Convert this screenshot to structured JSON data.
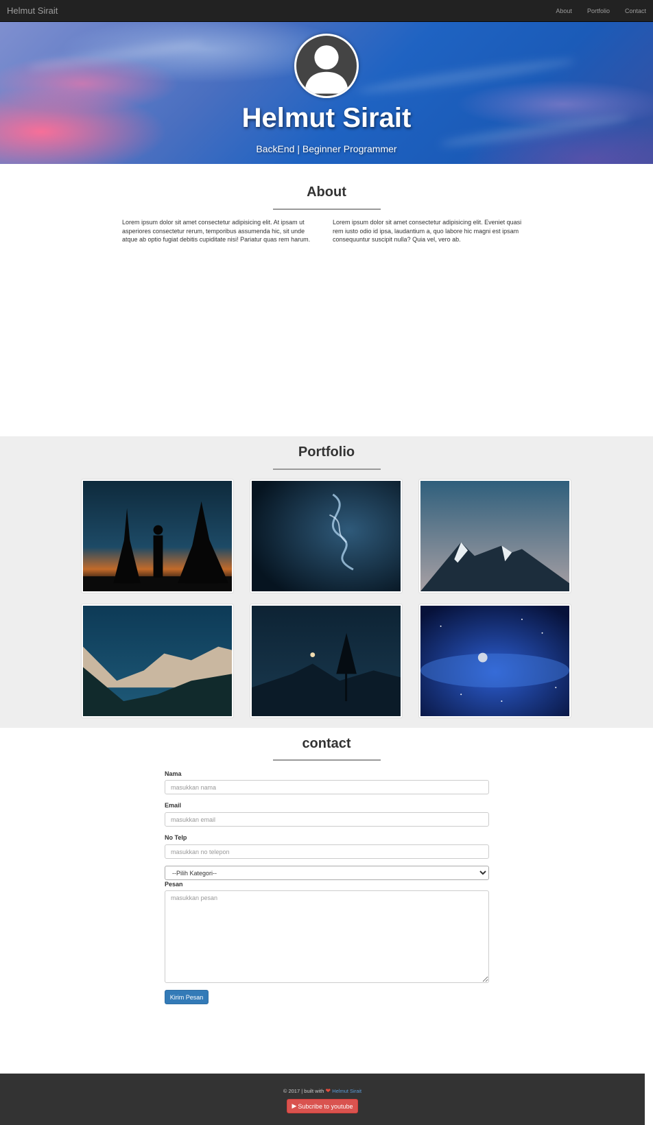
{
  "navbar": {
    "brand": "Helmut Sirait",
    "links": [
      "About",
      "Portfolio",
      "Contact"
    ]
  },
  "hero": {
    "avatar_icon": "user-avatar-icon",
    "title": "Helmut Sirait",
    "subtitle": "BackEnd | Beginner Programmer"
  },
  "about": {
    "title": "About",
    "columns": [
      "Lorem ipsum dolor sit amet consectetur adipisicing elit. At ipsam ut asperiores consectetur rerum, temporibus assumenda hic, sit unde atque ab optio fugiat debitis cupiditate nisi! Pariatur quas rem harum.",
      "Lorem ipsum dolor sit amet consectetur adipisicing elit. Eveniet quasi rem iusto odio id ipsa, laudantium a, quo labore hic magni est ipsam consequuntur suscipit nulla? Quia vel, vero ab."
    ]
  },
  "portfolio": {
    "title": "Portfolio"
  },
  "contact": {
    "title": "contact",
    "name_label": "Nama",
    "name_placeholder": "masukkan nama",
    "email_label": "Email",
    "email_placeholder": "masukkan email",
    "phone_label": "No Telp",
    "phone_placeholder": "masukkan no telepon",
    "category_selected": "--Pilih Kategori--",
    "message_label": "Pesan",
    "message_placeholder": "masukkan pesan",
    "submit_label": "Kirim Pesan"
  },
  "footer": {
    "copyright": "© 2017 | built with",
    "heart_icon": "heart-icon",
    "author_link": "Helmut Sirait",
    "subscribe_label": "Subcribe to youtube",
    "play_icon": "play-icon"
  },
  "colors": {
    "navbar": "#222222",
    "primary": "#337ab7",
    "danger": "#d9534f",
    "section_bg": "#eeeeee",
    "footer": "#333333"
  }
}
